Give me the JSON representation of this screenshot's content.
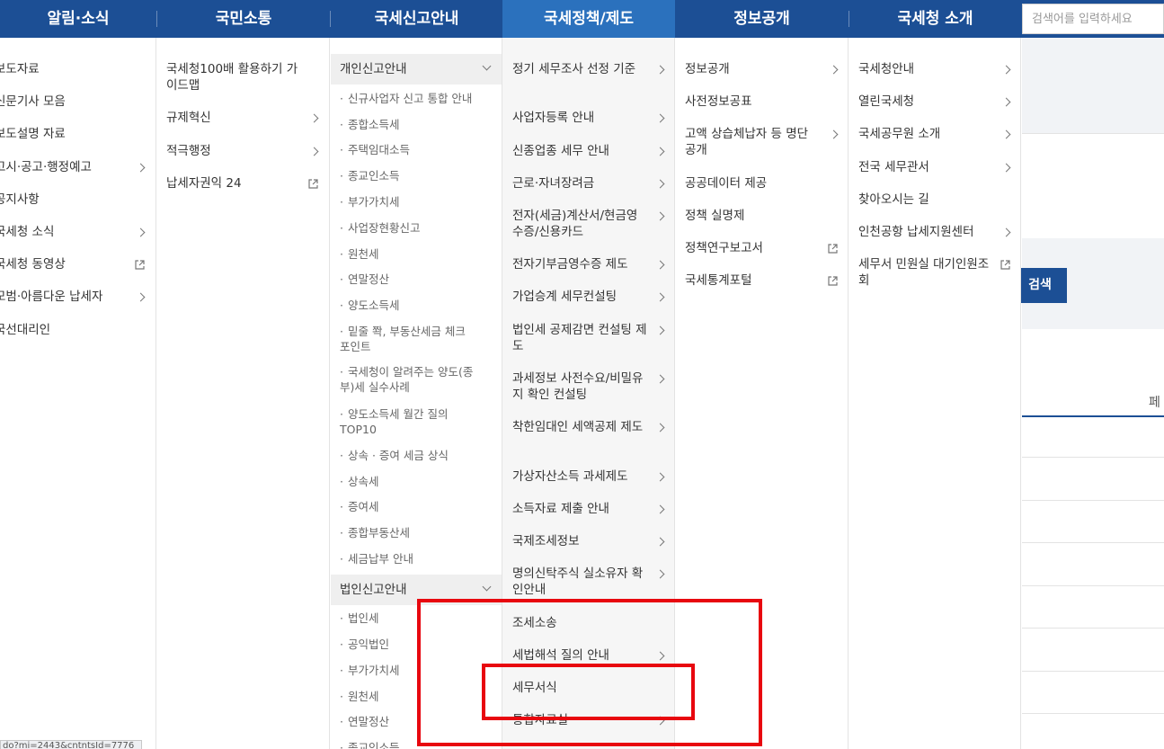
{
  "topnav": {
    "items": [
      "알림·소식",
      "국민소통",
      "국세신고안내",
      "국세정책/제도",
      "정보공개",
      "국세청 소개"
    ],
    "active_index": 3,
    "search_placeholder": "검색어를 입력하세요"
  },
  "col1": {
    "items": [
      {
        "label": "보도자료",
        "chevron": false,
        "external": false
      },
      {
        "label": "신문기사 모음",
        "chevron": false,
        "external": false
      },
      {
        "label": "보도설명 자료",
        "chevron": false,
        "external": false
      },
      {
        "label": "고시·공고·행정예고",
        "chevron": true,
        "external": false
      },
      {
        "label": "공지사항",
        "chevron": false,
        "external": false
      },
      {
        "label": "국세청 소식",
        "chevron": true,
        "external": false
      },
      {
        "label": "국세청 동영상",
        "chevron": false,
        "external": true
      },
      {
        "label": "모범·아름다운 납세자",
        "chevron": true,
        "external": false
      },
      {
        "label": "국선대리인",
        "chevron": false,
        "external": false
      }
    ]
  },
  "col2": {
    "items": [
      {
        "label": "국세청100배 활용하기 가이드맵",
        "chevron": false,
        "external": false
      },
      {
        "label": "규제혁신",
        "chevron": true,
        "external": false
      },
      {
        "label": "적극행정",
        "chevron": true,
        "external": false
      },
      {
        "label": "납세자권익 24",
        "chevron": false,
        "external": true
      }
    ]
  },
  "col3": {
    "group1": "개인신고안내",
    "group1_items": [
      "신규사업자 신고 통합 안내",
      "종합소득세",
      "주택임대소득",
      "종교인소득",
      "부가가치세",
      "사업장현황신고",
      "원천세",
      "연말정산",
      "양도소득세",
      "밑줄 쫙, 부동산세금 체크포인트",
      "국세청이 알려주는 양도(종부)세 실수사례",
      "양도소득세 월간 질의 TOP10",
      "상속 · 증여 세금 상식",
      "상속세",
      "증여세",
      "종합부동산세",
      "세금납부 안내"
    ],
    "group2": "법인신고안내",
    "group2_items": [
      "법인세",
      "공익법인",
      "부가가치세",
      "원천세",
      "연말정산",
      "종교인소득"
    ]
  },
  "col4": {
    "items": [
      {
        "label": "정기 세무조사 선정 기준",
        "chevron": true
      },
      {
        "label": "사업자등록 안내",
        "chevron": true
      },
      {
        "label": "신종업종 세무 안내",
        "chevron": true
      },
      {
        "label": "근로·자녀장려금",
        "chevron": true
      },
      {
        "label": "전자(세금)계산서/현금영수증/신용카드",
        "chevron": true
      },
      {
        "label": "전자기부금영수증 제도",
        "chevron": true
      },
      {
        "label": "가업승계 세무컨설팅",
        "chevron": true
      },
      {
        "label": "법인세 공제감면 컨설팅 제도",
        "chevron": true
      },
      {
        "label": "과세정보 사전수요/비밀유지 확인 컨설팅",
        "chevron": true
      },
      {
        "label": "착한임대인 세액공제 제도",
        "chevron": true
      },
      {
        "label": "가상자산소득 과세제도",
        "chevron": true
      },
      {
        "label": "소득자료 제출 안내",
        "chevron": true
      },
      {
        "label": "국제조세정보",
        "chevron": true
      },
      {
        "label": "명의신탁주식 실소유자 확인안내",
        "chevron": true
      },
      {
        "label": "조세소송",
        "chevron": false
      },
      {
        "label": "세법해석 질의 안내",
        "chevron": true
      },
      {
        "label": "세무서식",
        "chevron": false
      },
      {
        "label": "통합자료실",
        "chevron": true
      }
    ]
  },
  "col5": {
    "items": [
      {
        "label": "정보공개",
        "chevron": true,
        "external": false
      },
      {
        "label": "사전정보공표",
        "chevron": false,
        "external": false
      },
      {
        "label": "고액 상습체납자 등 명단 공개",
        "chevron": true,
        "external": false
      },
      {
        "label": "공공데이터 제공",
        "chevron": false,
        "external": false
      },
      {
        "label": "정책 실명제",
        "chevron": false,
        "external": false
      },
      {
        "label": "정책연구보고서",
        "chevron": false,
        "external": true
      },
      {
        "label": "국세통계포털",
        "chevron": false,
        "external": true
      }
    ]
  },
  "col6": {
    "items": [
      {
        "label": "국세청안내",
        "chevron": true,
        "external": false
      },
      {
        "label": "열린국세청",
        "chevron": true,
        "external": false
      },
      {
        "label": "국세공무원 소개",
        "chevron": true,
        "external": false
      },
      {
        "label": "전국 세무관서",
        "chevron": true,
        "external": false
      },
      {
        "label": "찾아오시는 길",
        "chevron": false,
        "external": false
      },
      {
        "label": "인천공항 납세지원센터",
        "chevron": true,
        "external": false
      },
      {
        "label": "세무서 민원실 대기인원조회",
        "chevron": false,
        "external": true
      }
    ]
  },
  "background": {
    "search_button": "검색",
    "page_label": "페"
  },
  "statusbar": {
    "url": "do?mi=2443&cntntsId=7776"
  },
  "colors": {
    "nav_bg": "#1c4f95",
    "nav_active": "#2b71bd",
    "annotation_red": "#e8070f"
  }
}
